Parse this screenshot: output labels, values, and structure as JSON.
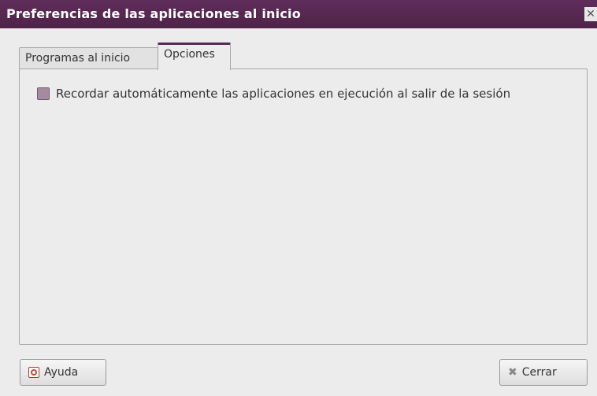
{
  "window": {
    "title": "Preferencias de las aplicaciones al inicio",
    "close_glyph": "✕"
  },
  "tabs": [
    {
      "label": "Programas al inicio",
      "active": false
    },
    {
      "label": "Opciones",
      "active": true
    }
  ],
  "options": {
    "remember_apps": {
      "label": "Recordar automáticamente las aplicaciones en ejecución al salir de la sesión",
      "checked": false
    }
  },
  "buttons": {
    "help": {
      "label": "Ayuda",
      "icon": "help-icon"
    },
    "close": {
      "label": "Cerrar",
      "icon": "close-icon",
      "glyph": "✖"
    }
  },
  "colors": {
    "accent": "#5a2a55",
    "checkbox": "#a58aa2"
  }
}
